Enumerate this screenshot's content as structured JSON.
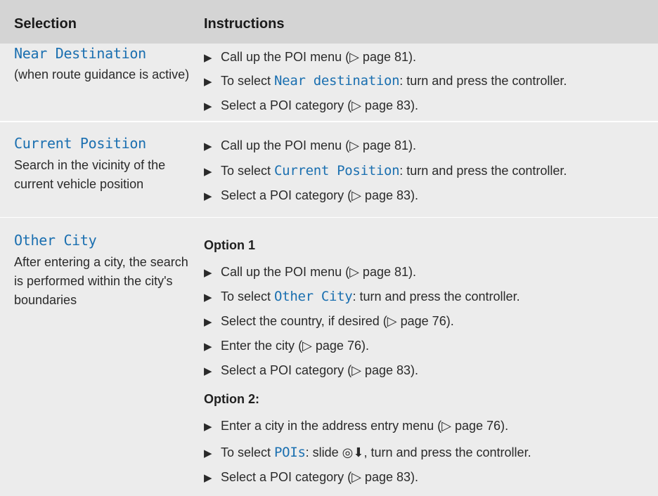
{
  "header": {
    "col1": "Selection",
    "col2": "Instructions"
  },
  "ref": "(▷ page 81)",
  "rows": [
    {
      "term": "Near Destination",
      "desc": "(when route guidance is active)",
      "steps": [
        {
          "pre": "Call up the POI menu ",
          "ref": "(▷ page 81)",
          "post": "."
        },
        {
          "pre": "To select ",
          "code": "Near destination",
          "post": ": turn and press the controller."
        },
        {
          "pre": "Select a POI category ",
          "ref": "(▷ page 83)",
          "post": "."
        }
      ]
    },
    {
      "term": "Current Position",
      "desc": "Search in the vicinity of the current vehicle position",
      "steps": [
        {
          "pre": "Call up the POI menu ",
          "ref": "(▷ page 81)",
          "post": "."
        },
        {
          "pre": "To select ",
          "code": "Current Position",
          "post": ": turn and press the controller."
        },
        {
          "pre": "Select a POI category ",
          "ref": "(▷ page 83)",
          "post": "."
        }
      ]
    },
    {
      "term": "Other City",
      "desc": "After entering a city, the search is performed within the city's boundaries",
      "option1": "Option 1",
      "option1_steps": [
        {
          "pre": "Call up the POI menu ",
          "ref": "(▷ page 81)",
          "post": "."
        },
        {
          "pre": "To select ",
          "code": "Other City",
          "post": ": turn and press the controller."
        },
        {
          "pre": "Select the country, if desired ",
          "ref": "(▷ page 76)",
          "post": "."
        },
        {
          "pre": "Enter the city ",
          "ref": "(▷ page 76)",
          "post": "."
        },
        {
          "pre": "Select a POI category ",
          "ref": "(▷ page 83)",
          "post": "."
        }
      ],
      "option2": "Option 2:",
      "option2_steps": [
        {
          "pre": "Enter a city in the address entry menu ",
          "ref": "(▷ page 76)",
          "post": "."
        },
        {
          "pre": "To select ",
          "code": "POIs",
          "mid": ": slide ",
          "icon": "◎⬇",
          "post": ", turn and press the controller."
        },
        {
          "pre": "Select a POI category ",
          "ref": "(▷ page 83)",
          "post": "."
        }
      ]
    }
  ],
  "bullet": "▶",
  "icons": {
    "step_bullet": "triangle-right",
    "controller": "controller-slide-down"
  }
}
